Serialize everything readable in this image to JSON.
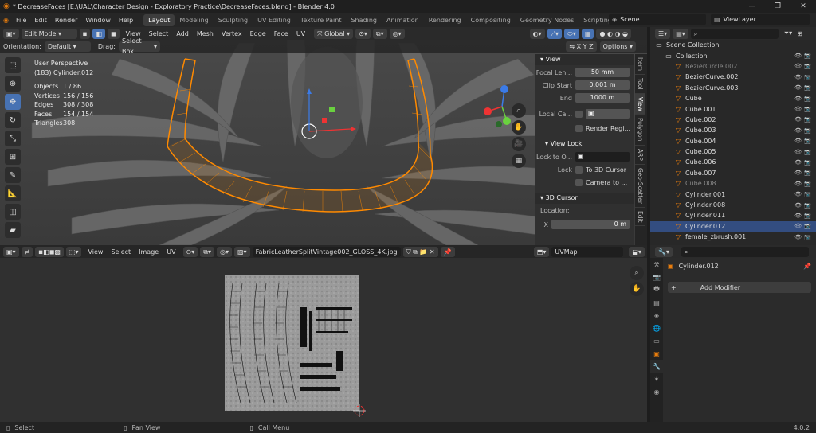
{
  "window": {
    "title": "* DecreaseFaces [E:\\UAL\\Character Design - Exploratory Practice\\DecreaseFaces.blend] - Blender 4.0",
    "controls": [
      "—",
      "❐",
      "✕"
    ]
  },
  "menu": [
    "File",
    "Edit",
    "Render",
    "Window",
    "Help"
  ],
  "workspaces": [
    "Layout",
    "Modeling",
    "Sculpting",
    "UV Editing",
    "Texture Paint",
    "Shading",
    "Animation",
    "Rendering",
    "Compositing",
    "Geometry Nodes",
    "Scripting",
    "+"
  ],
  "scene_name": "Scene",
  "view_layer": "ViewLayer",
  "viewport": {
    "mode": "Edit Mode",
    "menus": [
      "View",
      "Select",
      "Add",
      "Mesh",
      "Vertex",
      "Edge",
      "Face",
      "UV"
    ],
    "transform_orientation": "Global",
    "orientation_label": "Orientation:",
    "orientation_value": "Default",
    "drag_label": "Drag:",
    "drag_value": "Select Box",
    "options_label": "Options",
    "perspective": "User Perspective",
    "object_info": "(183) Cylinder.012",
    "stats": [
      {
        "label": "Objects",
        "value": "1 / 86"
      },
      {
        "label": "Vertices",
        "value": "156 / 156"
      },
      {
        "label": "Edges",
        "value": "308 / 308"
      },
      {
        "label": "Faces",
        "value": "154 / 154"
      },
      {
        "label": "Triangles",
        "value": "308"
      }
    ]
  },
  "npanel": {
    "view_header": "View",
    "focal_label": "Focal Len...",
    "focal_value": "50 mm",
    "clip_start_label": "Clip Start",
    "clip_start_value": "0.001 m",
    "end_label": "End",
    "end_value": "1000 m",
    "local_cam_label": "Local Ca...",
    "render_region_label": "Render Regi...",
    "view_lock_header": "View Lock",
    "lock_to_obj_label": "Lock to O...",
    "lock_label": "Lock",
    "to_3d_cursor": "To 3D Cursor",
    "camera_to": "Camera to ...",
    "cursor_header": "3D Cursor",
    "location_label": "Location:",
    "x_label": "X",
    "x_value": "0 m",
    "tabs": [
      "Item",
      "Tool",
      "View",
      "Polygon",
      "ARP",
      "Geo-Scatter",
      "Edit"
    ]
  },
  "uv": {
    "menus": [
      "View",
      "Select",
      "Image",
      "UV"
    ],
    "image_name": "FabricLeatherSplitVintage002_GLOSS_4K.jpg",
    "uvmap": "UVMap"
  },
  "outliner": {
    "items": [
      {
        "name": "Scene Collection",
        "level": 0,
        "icon": "collection-icon"
      },
      {
        "name": "Collection",
        "level": 1,
        "icon": "collection-icon"
      },
      {
        "name": "BezierCircle.002",
        "level": 2,
        "icon": "curve-icon",
        "dim": true
      },
      {
        "name": "BezierCurve.002",
        "level": 2,
        "icon": "curve-icon"
      },
      {
        "name": "BezierCurve.003",
        "level": 2,
        "icon": "curve-icon"
      },
      {
        "name": "Cube",
        "level": 2,
        "icon": "mesh-icon"
      },
      {
        "name": "Cube.001",
        "level": 2,
        "icon": "mesh-icon"
      },
      {
        "name": "Cube.002",
        "level": 2,
        "icon": "mesh-icon"
      },
      {
        "name": "Cube.003",
        "level": 2,
        "icon": "mesh-icon"
      },
      {
        "name": "Cube.004",
        "level": 2,
        "icon": "mesh-icon"
      },
      {
        "name": "Cube.005",
        "level": 2,
        "icon": "mesh-icon"
      },
      {
        "name": "Cube.006",
        "level": 2,
        "icon": "mesh-icon"
      },
      {
        "name": "Cube.007",
        "level": 2,
        "icon": "mesh-icon"
      },
      {
        "name": "Cube.008",
        "level": 2,
        "icon": "mesh-icon",
        "dim": true
      },
      {
        "name": "Cylinder.001",
        "level": 2,
        "icon": "mesh-icon"
      },
      {
        "name": "Cylinder.008",
        "level": 2,
        "icon": "curve-icon"
      },
      {
        "name": "Cylinder.011",
        "level": 2,
        "icon": "curve-icon"
      },
      {
        "name": "Cylinder.012",
        "level": 2,
        "icon": "mesh-icon",
        "selected": true
      },
      {
        "name": "female_zbrush.001",
        "level": 2,
        "icon": "mesh-icon"
      }
    ]
  },
  "properties": {
    "object_name": "Cylinder.012",
    "add_modifier": "Add Modifier"
  },
  "status": {
    "select": "Select",
    "pan": "Pan View",
    "call_menu": "Call Menu",
    "version": "4.0.2"
  },
  "colors": {
    "accent": "#4772b3",
    "mesh_orange": "#ff8a00",
    "selected_row": "#334d80"
  }
}
